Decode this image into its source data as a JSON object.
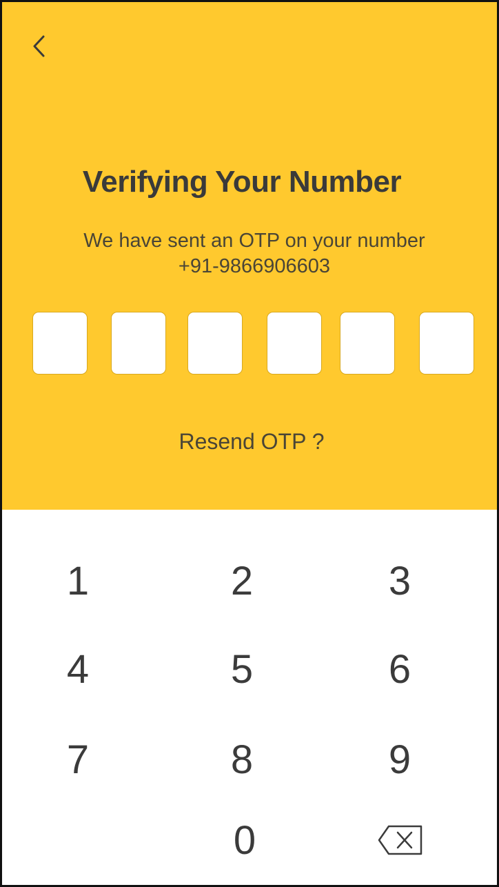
{
  "header": {
    "title": "Verifying Your Number",
    "subtitle_line1": "We have sent an OTP on your number",
    "phone_number": "+91-9866906603",
    "resend_label": "Resend OTP ?",
    "background_color": "#ffc92e"
  },
  "otp": {
    "digits": [
      "",
      "",
      "",
      "",
      "",
      ""
    ]
  },
  "keypad": {
    "keys": [
      "1",
      "2",
      "3",
      "4",
      "5",
      "6",
      "7",
      "8",
      "9",
      "0"
    ],
    "backspace_icon": "backspace-icon"
  },
  "icons": {
    "back": "chevron-left-icon"
  }
}
